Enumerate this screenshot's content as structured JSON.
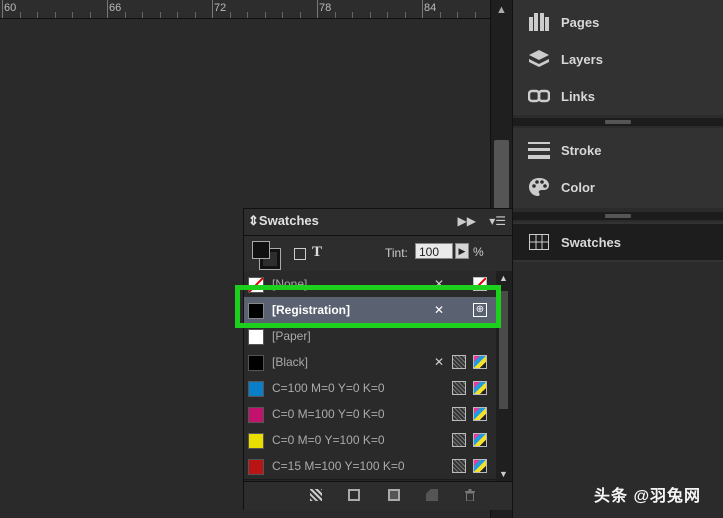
{
  "ruler": {
    "labels": [
      "60",
      "66",
      "72",
      "78",
      "84"
    ]
  },
  "dock": {
    "items": [
      {
        "label": "Pages",
        "icon": "pages-icon"
      },
      {
        "label": "Layers",
        "icon": "layers-icon"
      },
      {
        "label": "Links",
        "icon": "links-icon"
      },
      {
        "label": "Stroke",
        "icon": "stroke-icon"
      },
      {
        "label": "Color",
        "icon": "color-palette-icon"
      },
      {
        "label": "Swatches",
        "icon": "swatches-grid-icon"
      }
    ]
  },
  "swatches_panel": {
    "title": "Swatches",
    "tint_label": "Tint:",
    "tint_value": "100",
    "tint_unit": "%",
    "rows": [
      {
        "name": "[None]",
        "color": "none"
      },
      {
        "name": "[Registration]",
        "color": "#000000",
        "selected": true
      },
      {
        "name": "[Paper]",
        "color": "#ffffff"
      },
      {
        "name": "[Black]",
        "color": "#000000"
      },
      {
        "name": "C=100 M=0 Y=0 K=0",
        "color": "#0a7fc9"
      },
      {
        "name": "C=0 M=100 Y=0 K=0",
        "color": "#c2126d"
      },
      {
        "name": "C=0 M=0 Y=100 K=0",
        "color": "#e8df00"
      },
      {
        "name": "C=15 M=100 Y=100 K=0",
        "color": "#b81414"
      }
    ]
  },
  "highlight_color": "#1ed01e",
  "watermark": "头条 @羽兔网"
}
